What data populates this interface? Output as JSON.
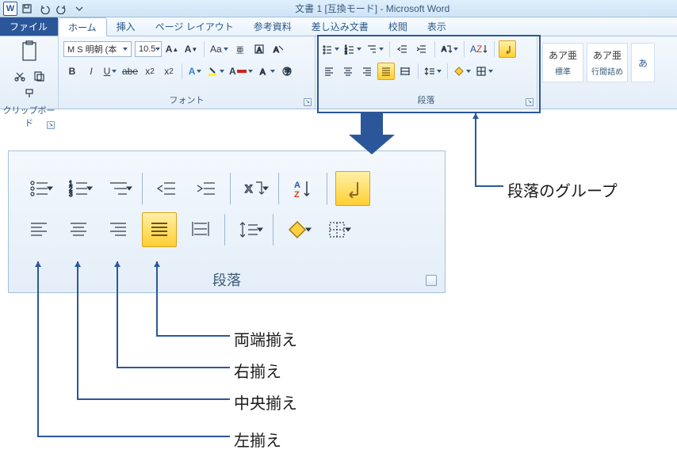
{
  "titlebar": {
    "title": "文書 1 [互換モード] - Microsoft Word",
    "app_icon_text": "W"
  },
  "tabs": {
    "file": "ファイル",
    "home": "ホーム",
    "insert": "挿入",
    "layout": "ページ レイアウト",
    "ref": "参考資料",
    "mail": "差し込み文書",
    "review": "校閲",
    "view": "表示"
  },
  "ribbon": {
    "clipboard": {
      "label": "クリップボード",
      "paste": "貼り付け"
    },
    "font": {
      "label": "フォント",
      "name": "M S 明朝 (本",
      "size": "10.5",
      "bold": "B",
      "italic": "I",
      "underline": "U"
    },
    "paragraph": {
      "label": "段落"
    },
    "styles": {
      "preview": "あア亜",
      "normal": "標準",
      "nospace": "行間詰め"
    }
  },
  "big_panel": {
    "label": "段落"
  },
  "annotations": {
    "group_label": "段落のグループ",
    "justify": "両端揃え",
    "right": "右揃え",
    "center": "中央揃え",
    "left": "左揃え"
  }
}
